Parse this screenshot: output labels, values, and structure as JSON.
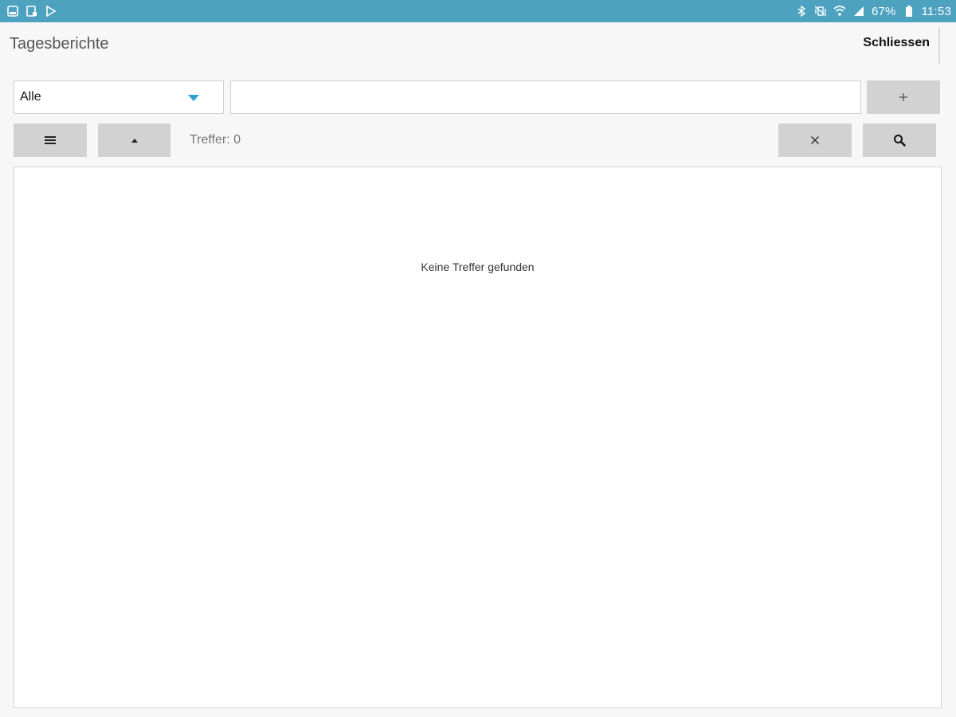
{
  "status_bar": {
    "battery_text": "67%",
    "time": "11:53",
    "background_color": "#4da2c0",
    "left_icons": [
      "gallery-icon",
      "clipboard-icon",
      "play-store-icon"
    ],
    "right_icons": [
      "bluetooth-icon",
      "vibrate-icon",
      "wifi-icon",
      "signal-icon",
      "battery-icon"
    ]
  },
  "header": {
    "title": "Tagesberichte",
    "close_label": "Schliessen"
  },
  "filter": {
    "selected": "Alle",
    "caret_color": "#2e9fd4",
    "search_value": "",
    "search_placeholder": "",
    "add_icon": "plus-icon"
  },
  "toolbar": {
    "hits_text": "Treffer: 0",
    "menu_icon": "hamburger-icon",
    "sort_icon": "triangle-up-icon",
    "clear_icon": "close-icon",
    "search_icon": "search-icon"
  },
  "results": {
    "empty_text": "Keine Treffer gefunden"
  },
  "colors": {
    "button_bg": "#d2d2d2",
    "page_bg": "#f7f7f7"
  }
}
